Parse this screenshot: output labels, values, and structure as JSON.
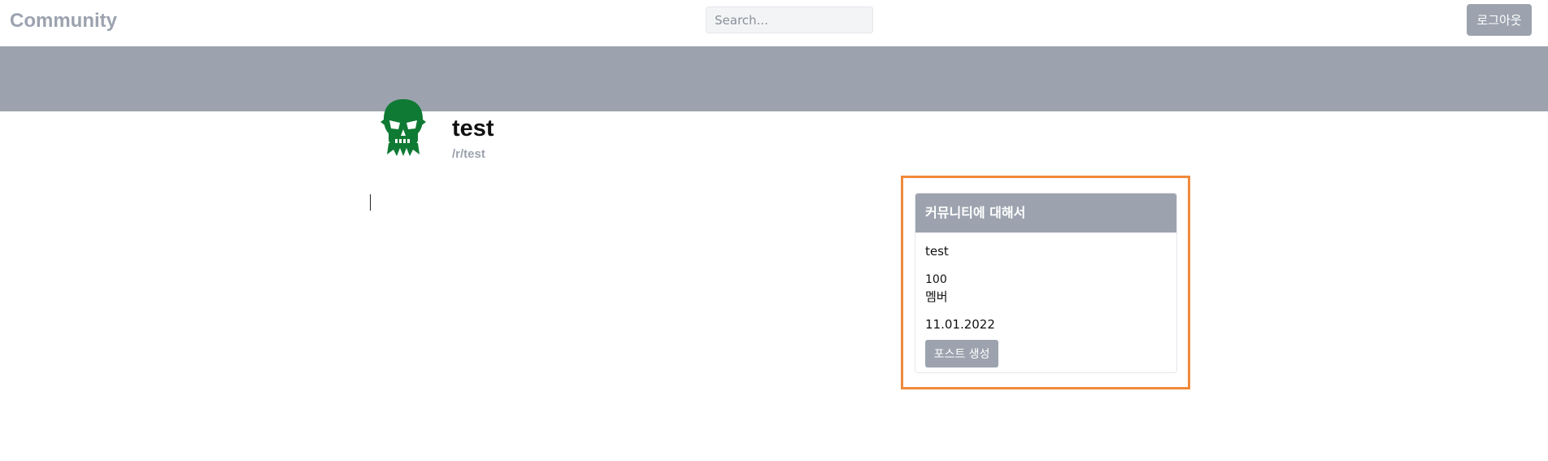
{
  "navbar": {
    "brand": "Community",
    "search_placeholder": "Search...",
    "logout_label": "로그아웃"
  },
  "community": {
    "name": "test",
    "slug": "/r/test",
    "avatar_icon": "skull-icon",
    "avatar_color": "#0f7a33"
  },
  "sidebar": {
    "title": "커뮤니티에 대해서",
    "description": "test",
    "member_count": "100",
    "member_label": "멤버",
    "created_date": "11.01.2022",
    "create_post_label": "포스트 생성"
  },
  "colors": {
    "accent_gray": "#9ca3af",
    "highlight_orange": "#f08a3a"
  }
}
